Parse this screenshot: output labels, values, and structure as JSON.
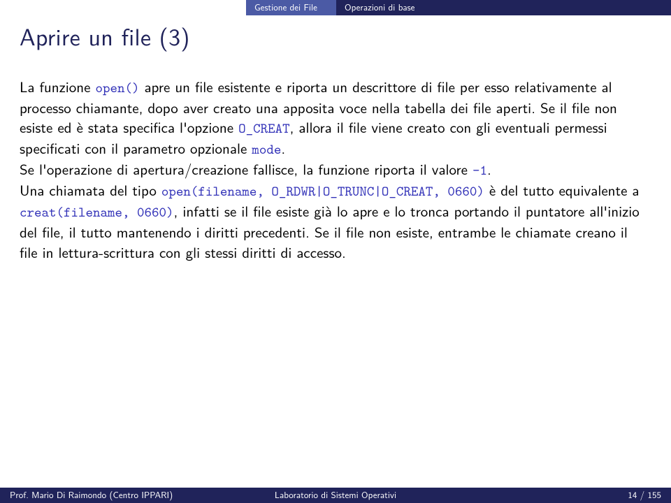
{
  "nav": {
    "section": "Gestione dei File",
    "subsection": "Operazioni di base"
  },
  "title": "Aprire un file (3)",
  "body": {
    "t1a": "La funzione ",
    "c1": "open()",
    "t1b": " apre un file esistente e riporta un descrittore di file per esso relativamente al processo chiamante, dopo aver creato una apposita voce nella tabella dei file aperti. Se il file non esiste ed è stata specifica l'opzione ",
    "c2": "O_CREAT",
    "t1c": ", allora il file viene creato con gli eventuali permessi specificati con il parametro opzionale ",
    "c3": "mode",
    "t1d": ".",
    "t2a": "Se l'operazione di apertura/creazione fallisce, la funzione riporta il valore ",
    "c4": "-1",
    "t2b": ".",
    "t3a": "Una chiamata del tipo ",
    "c5": "open(filename, O_RDWR|O_TRUNC|O_CREAT, 0660)",
    "t3b": " è del tutto equivalente a ",
    "c6": "creat(filename, 0660)",
    "t3c": ", infatti se il file esiste già lo apre e lo tronca portando il puntatore all'inizio del file, il tutto mantenendo i diritti precedenti. Se il file non esiste, entrambe le chiamate creano il file in lettura-scrittura con gli stessi diritti di accesso."
  },
  "footer": {
    "author": "Prof. Mario Di Raimondo (Centro IPPARI)",
    "course": "Laboratorio di Sistemi Operativi",
    "page": "14 / 155"
  }
}
